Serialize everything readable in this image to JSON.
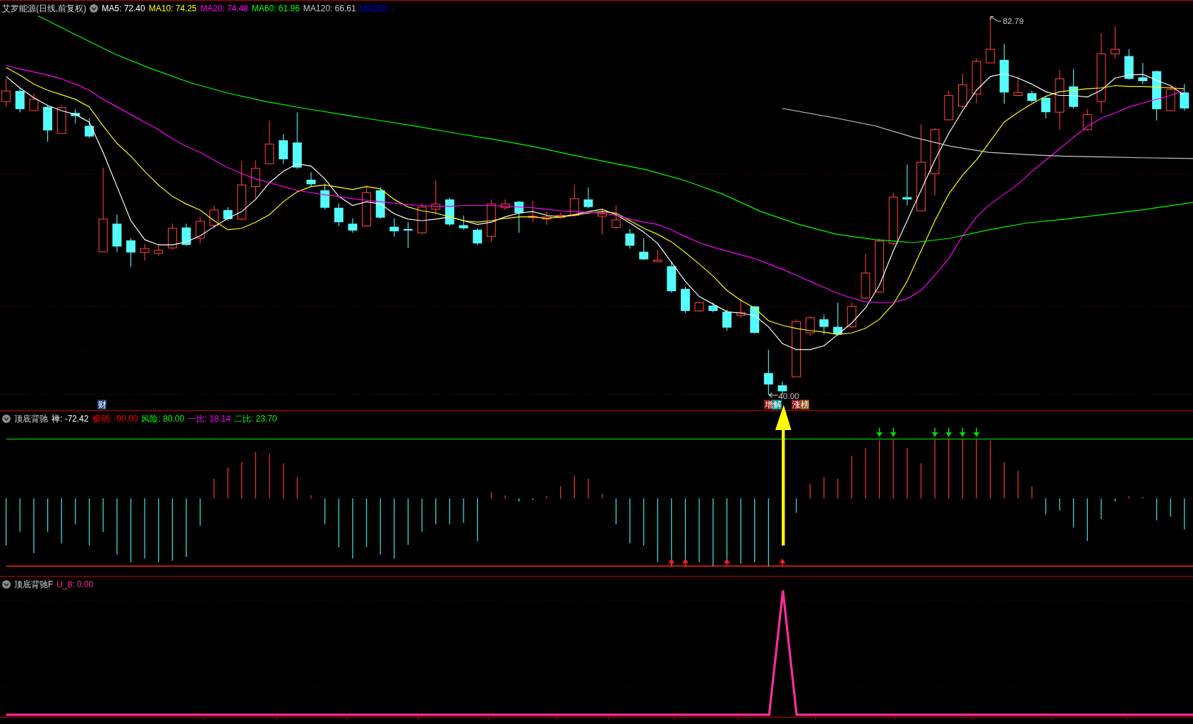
{
  "main_chart": {
    "title": "艾罗能源(日线,前复权)",
    "moving_averages": [
      {
        "label": "MA5: 72.40",
        "color": "#ffffff"
      },
      {
        "label": "MA10: 74.25",
        "color": "#ffff00"
      },
      {
        "label": "MA20: 74.48",
        "color": "#ff00ff"
      },
      {
        "label": "MA60: 61.96",
        "color": "#00ff00"
      },
      {
        "label": "MA120: 66.61",
        "color": "#c8c8c8"
      },
      {
        "label": "MA250: -",
        "color": "#0000ff"
      }
    ],
    "high_label": "82.79",
    "low_label": "40.00",
    "tags": [
      {
        "text": "财",
        "color": "#1e3f7a"
      },
      {
        "text": "增",
        "color": "#8b1010"
      },
      {
        "text": "解",
        "color": "#11888a"
      },
      {
        "text": "涨",
        "color": "#8b1010"
      },
      {
        "text": "榜",
        "color": "#8b4a12"
      }
    ]
  },
  "indicator_1": {
    "title": "顶底背驰",
    "values": [
      {
        "label": "禅: -72.42",
        "color": "#ffffff"
      },
      {
        "label": "极弱: -90.00",
        "color": "#ff0000"
      },
      {
        "label": "风险: 80.00",
        "color": "#00ff00"
      },
      {
        "label": "一比: 18.14",
        "color": "#ff00ff"
      },
      {
        "label": "二比: 23.70",
        "color": "#00ff00"
      }
    ]
  },
  "indicator_2": {
    "title": "顶底背驰F",
    "values": [
      {
        "label": "U_8: 0.00",
        "color": "#ff2d9b"
      }
    ]
  }
}
